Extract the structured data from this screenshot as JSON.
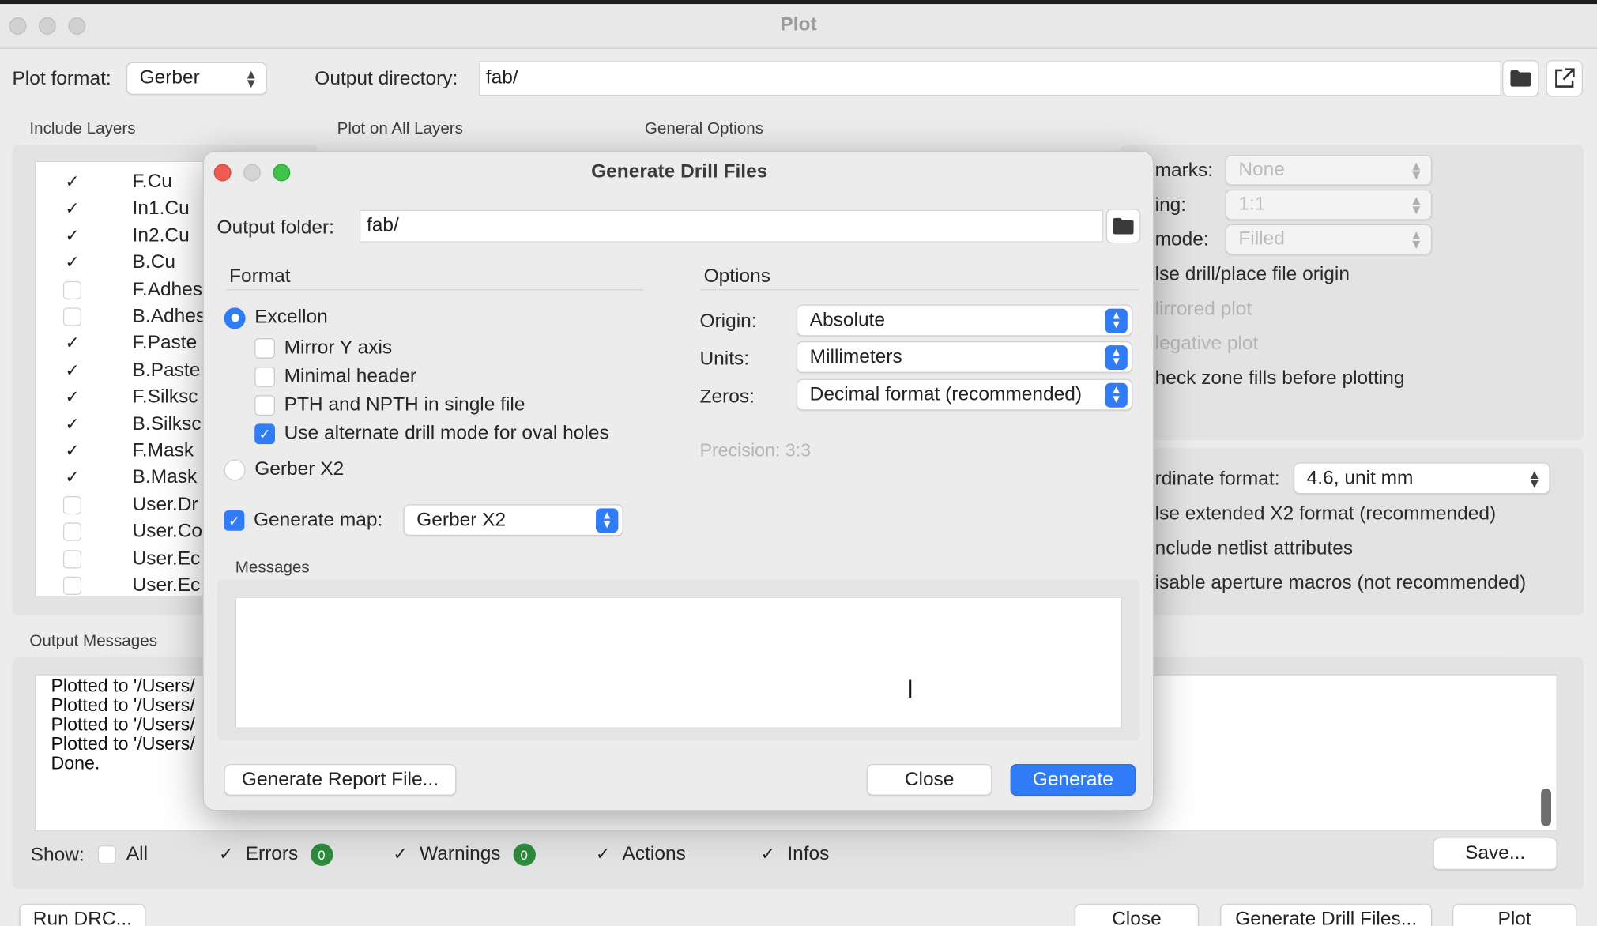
{
  "window": {
    "title": "Plot"
  },
  "plot_header": {
    "format_label": "Plot format:",
    "format_value": "Gerber",
    "output_dir_label": "Output directory:",
    "output_dir_value": "fab/"
  },
  "sections": {
    "include_layers": "Include Layers",
    "plot_all_layers": "Plot on All Layers",
    "general_options": "General Options",
    "output_messages": "Output Messages"
  },
  "layers": [
    {
      "name": "F.Cu",
      "checked": true
    },
    {
      "name": "In1.Cu",
      "checked": true
    },
    {
      "name": "In2.Cu",
      "checked": true
    },
    {
      "name": "B.Cu",
      "checked": true
    },
    {
      "name": "F.Adhes",
      "checked": false
    },
    {
      "name": "B.Adhes",
      "checked": false
    },
    {
      "name": "F.Paste",
      "checked": true
    },
    {
      "name": "B.Paste",
      "checked": true
    },
    {
      "name": "F.Silksc",
      "checked": true
    },
    {
      "name": "B.Silksc",
      "checked": true
    },
    {
      "name": "F.Mask",
      "checked": true
    },
    {
      "name": "B.Mask",
      "checked": true
    },
    {
      "name": "User.Dr",
      "checked": false
    },
    {
      "name": "User.Co",
      "checked": false
    },
    {
      "name": "User.Ec",
      "checked": false
    },
    {
      "name": "User.Ec",
      "checked": false
    }
  ],
  "general": {
    "marks_label": "marks:",
    "marks_value": "None",
    "scaling_label": "ing:",
    "scaling_value": "1:1",
    "mode_label": "mode:",
    "mode_value": "Filled",
    "opt_drill_origin": "lse drill/place file origin",
    "opt_mirrored": "lirrored plot",
    "opt_negative": "legative plot",
    "opt_check_zone": "heck zone fills before plotting",
    "coord_label": "rdinate format:",
    "coord_value": "4.6, unit mm",
    "opt_x2": "lse extended X2 format (recommended)",
    "opt_netlist": "nclude netlist attributes",
    "opt_aperture": "isable aperture macros (not recommended)"
  },
  "output_messages": [
    "Plotted to '/Users/",
    "Plotted to '/Users/",
    "Plotted to '/Users/",
    "Plotted to '/Users/",
    "Done."
  ],
  "filters": {
    "show_label": "Show:",
    "all": "All",
    "errors": "Errors",
    "errors_count": "0",
    "warnings": "Warnings",
    "warnings_count": "0",
    "actions": "Actions",
    "infos": "Infos",
    "save": "Save..."
  },
  "bottom_buttons": {
    "run_drc": "Run DRC...",
    "close": "Close",
    "generate_drill": "Generate Drill Files...",
    "plot": "Plot"
  },
  "dialog": {
    "title": "Generate Drill Files",
    "output_folder_label": "Output folder:",
    "output_folder_value": "fab/",
    "format_title": "Format",
    "excellon": "Excellon",
    "mirror_y": "Mirror Y axis",
    "minimal_header": "Minimal header",
    "pth_npth": "PTH and NPTH in single file",
    "alt_drill": "Use alternate drill mode for oval holes",
    "gerber_x2": "Gerber X2",
    "generate_map": "Generate map:",
    "map_format": "Gerber X2",
    "options_title": "Options",
    "origin_label": "Origin:",
    "origin_value": "Absolute",
    "units_label": "Units:",
    "units_value": "Millimeters",
    "zeros_label": "Zeros:",
    "zeros_value": "Decimal format (recommended)",
    "precision": "Precision:  3:3",
    "messages_title": "Messages",
    "report_button": "Generate Report File...",
    "close_button": "Close",
    "generate_button": "Generate"
  },
  "colors": {
    "accent": "#2f7cf6",
    "badge_green": "#2d8a3e",
    "traffic_red": "#ee5b52",
    "traffic_green": "#3ec44a"
  }
}
